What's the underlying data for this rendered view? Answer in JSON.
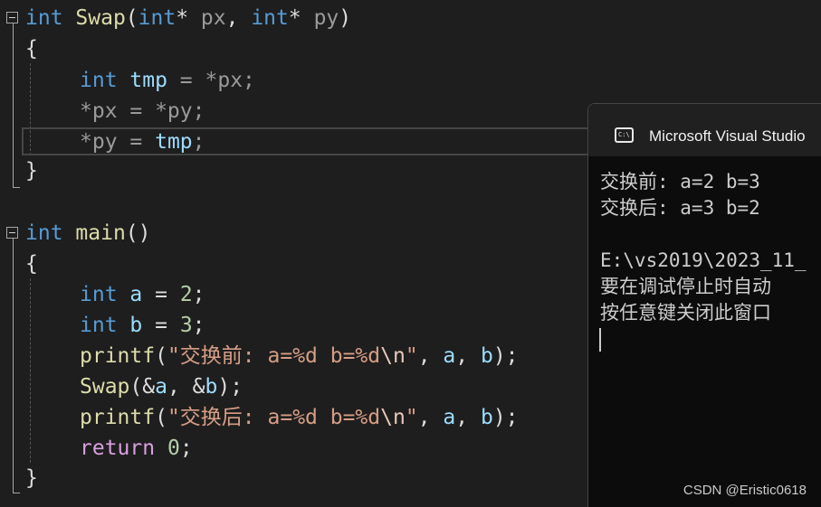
{
  "editor": {
    "swap_signature": {
      "ret": "int",
      "name": "Swap",
      "lp": "(",
      "t1": "int",
      "star1": "* ",
      "p1": "px",
      "comma": ", ",
      "t2": "int",
      "star2": "* ",
      "p2": "py",
      "rp": ")"
    },
    "swap_open": "{",
    "line_tmp": {
      "t": "int",
      "var": "tmp",
      "rest": " = *px;"
    },
    "line_px": {
      "text": "*px = *py;"
    },
    "line_py": {
      "pre": "*py = ",
      "var": "tmp",
      "end": ";"
    },
    "swap_close": "}",
    "main_signature": {
      "ret": "int",
      "name": "main",
      "parens": "()"
    },
    "main_open": "{",
    "line_a": {
      "t": "int",
      "var": "a",
      "eq": " = ",
      "num": "2",
      "end": ";"
    },
    "line_b": {
      "t": "int",
      "var": "b",
      "eq": " = ",
      "num": "3",
      "end": ";"
    },
    "line_printf1": {
      "fn": "printf",
      "lp": "(",
      "str": "\"交换前: a=%d b=%d",
      "esc": "\\n",
      "strend": "\"",
      "sep1": ", ",
      "a": "a",
      "sep2": ", ",
      "b": "b",
      "end": ");"
    },
    "line_swap_call": {
      "fn": "Swap",
      "lp": "(&",
      "a": "a",
      "sep": ", &",
      "b": "b",
      "end": ");"
    },
    "line_printf2": {
      "fn": "printf",
      "lp": "(",
      "str": "\"交换后: a=%d b=%d",
      "esc": "\\n",
      "strend": "\"",
      "sep1": ", ",
      "a": "a",
      "sep2": ", ",
      "b": "b",
      "end": ");"
    },
    "line_return": {
      "kw": "return",
      "sp": " ",
      "num": "0",
      "end": ";"
    },
    "main_close": "}"
  },
  "console": {
    "title": "Microsoft Visual Studio",
    "icon_label": "C:\\",
    "lines": [
      "交换前: a=2 b=3",
      "交换后: a=3 b=2",
      "",
      "E:\\vs2019\\2023_11_",
      "要在调试停止时自动",
      "按任意键关闭此窗口"
    ]
  },
  "watermark": "CSDN @Eristic0618",
  "colors": {
    "background": "#1e1e1e",
    "keyword": "#569cd6",
    "control_keyword": "#d8a0df",
    "function": "#dcdcaa",
    "local_variable": "#9cdcfe",
    "parameter": "#9a9a9a",
    "number": "#b5cea8",
    "string": "#d69d85",
    "console_bg": "#0c0c0c",
    "console_text": "#cccccc"
  },
  "icons": [
    "terminal-icon",
    "collapse-toggle-icon"
  ]
}
